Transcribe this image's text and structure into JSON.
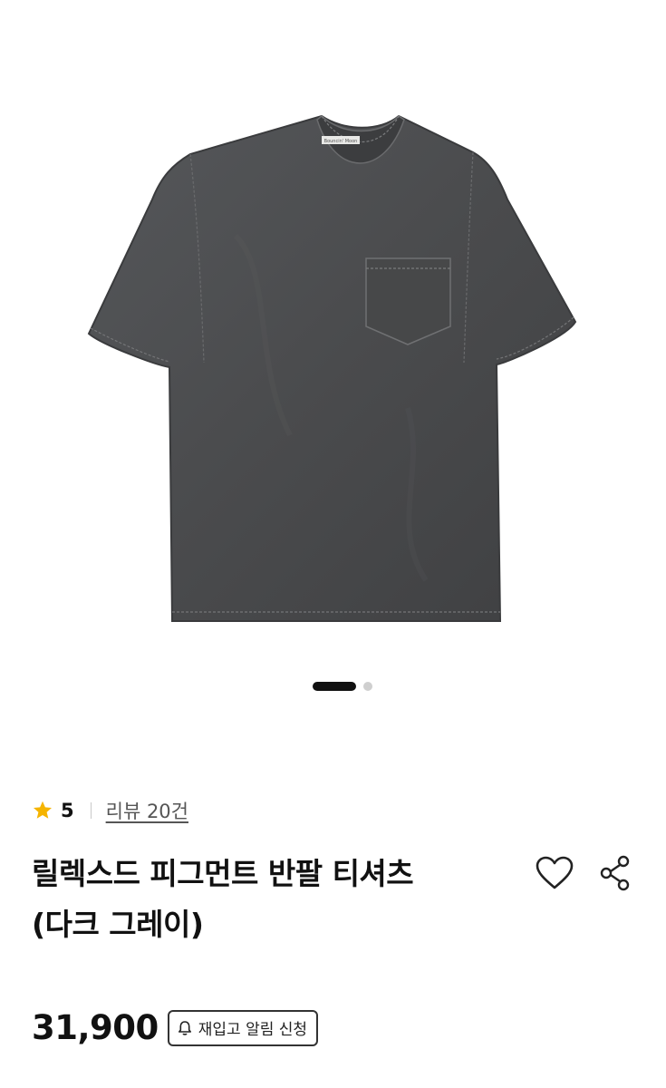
{
  "product": {
    "rating": "5",
    "review_link": "리뷰 20건",
    "title_line1": "릴렉스드 피그먼트 반팔 티셔츠",
    "title_line2": "(다크 그레이)",
    "price": "31,900",
    "restock_button": "재입고 알림 신청",
    "label_text": "Bouncin' Moon"
  },
  "carousel": {
    "total_slides": 2,
    "active_slide": 1
  },
  "colors": {
    "star": "#F5B400",
    "shirt": "#4a4b4c",
    "text": "#111111"
  },
  "icons": [
    "star-icon",
    "heart-icon",
    "share-icon",
    "bell-icon"
  ]
}
